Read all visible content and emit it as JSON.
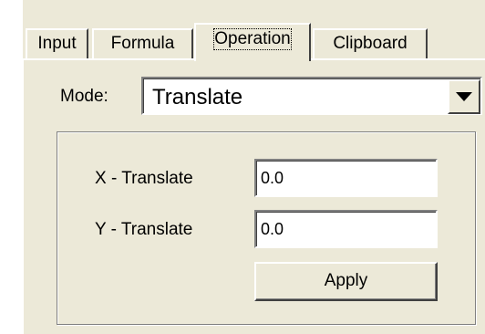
{
  "tabs": [
    {
      "label": "Input",
      "active": false
    },
    {
      "label": "Formula",
      "active": false
    },
    {
      "label": "Operation",
      "active": true
    },
    {
      "label": "Clipboard",
      "active": false
    }
  ],
  "mode": {
    "label": "Mode:",
    "selected": "Translate"
  },
  "fields": {
    "x_label": "X - Translate",
    "x_value": "0.0",
    "y_label": "Y - Translate",
    "y_value": "0.0"
  },
  "apply_label": "Apply",
  "colors": {
    "face": "#ece9d8",
    "highlight": "#ffffff",
    "shadow": "#808080",
    "dark_shadow": "#404040"
  },
  "icons": {
    "dropdown": "chevron-down-icon"
  }
}
